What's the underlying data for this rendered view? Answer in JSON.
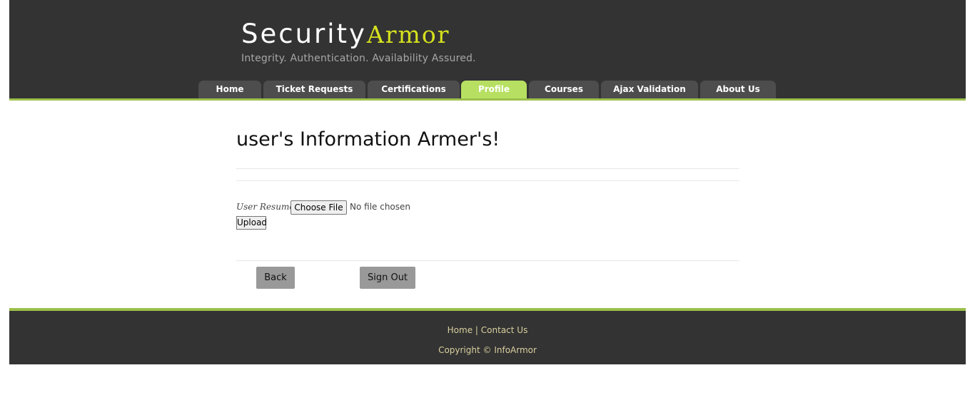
{
  "brand": {
    "name_part1": "Security",
    "name_part2": "Armor",
    "tagline": "Integrity. Authentication. Availability Assured."
  },
  "nav": {
    "tabs": [
      {
        "label": "Home"
      },
      {
        "label": "Ticket Requests"
      },
      {
        "label": "Certifications"
      },
      {
        "label": "Profile",
        "active": true
      },
      {
        "label": "Courses"
      },
      {
        "label": "Ajax Validation"
      },
      {
        "label": "About Us"
      }
    ]
  },
  "main": {
    "title": "user's Information Armer's!",
    "resume_label": "User Resume:",
    "choose_file_label": "Choose File",
    "no_file_text": "No file chosen",
    "upload_label": "Upload",
    "back_label": "Back",
    "signout_label": "Sign Out"
  },
  "footer": {
    "home_link": "Home",
    "separator": "|",
    "contact_link": "Contact Us",
    "copyright": "Copyright © InfoArmor"
  },
  "colors": {
    "header_bg": "#333333",
    "accent_green": "#9bbf4b",
    "active_tab": "#b7e062",
    "logo_yellow": "#d6e21d",
    "button_gray": "#999999"
  }
}
